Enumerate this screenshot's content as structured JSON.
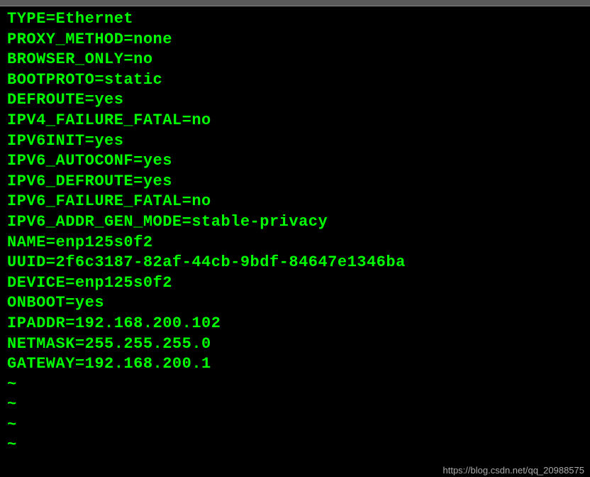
{
  "config": {
    "lines": [
      "TYPE=Ethernet",
      "PROXY_METHOD=none",
      "BROWSER_ONLY=no",
      "BOOTPROTO=static",
      "DEFROUTE=yes",
      "IPV4_FAILURE_FATAL=no",
      "IPV6INIT=yes",
      "IPV6_AUTOCONF=yes",
      "IPV6_DEFROUTE=yes",
      "IPV6_FAILURE_FATAL=no",
      "IPV6_ADDR_GEN_MODE=stable-privacy",
      "NAME=enp125s0f2",
      "UUID=2f6c3187-82af-44cb-9bdf-84647e1346ba",
      "DEVICE=enp125s0f2",
      "ONBOOT=yes",
      "IPADDR=192.168.200.102",
      "NETMASK=255.255.255.0",
      "GATEWAY=192.168.200.1"
    ],
    "tildes": [
      "~",
      "~",
      "~",
      "~"
    ]
  },
  "watermark": "https://blog.csdn.net/qq_20988575"
}
